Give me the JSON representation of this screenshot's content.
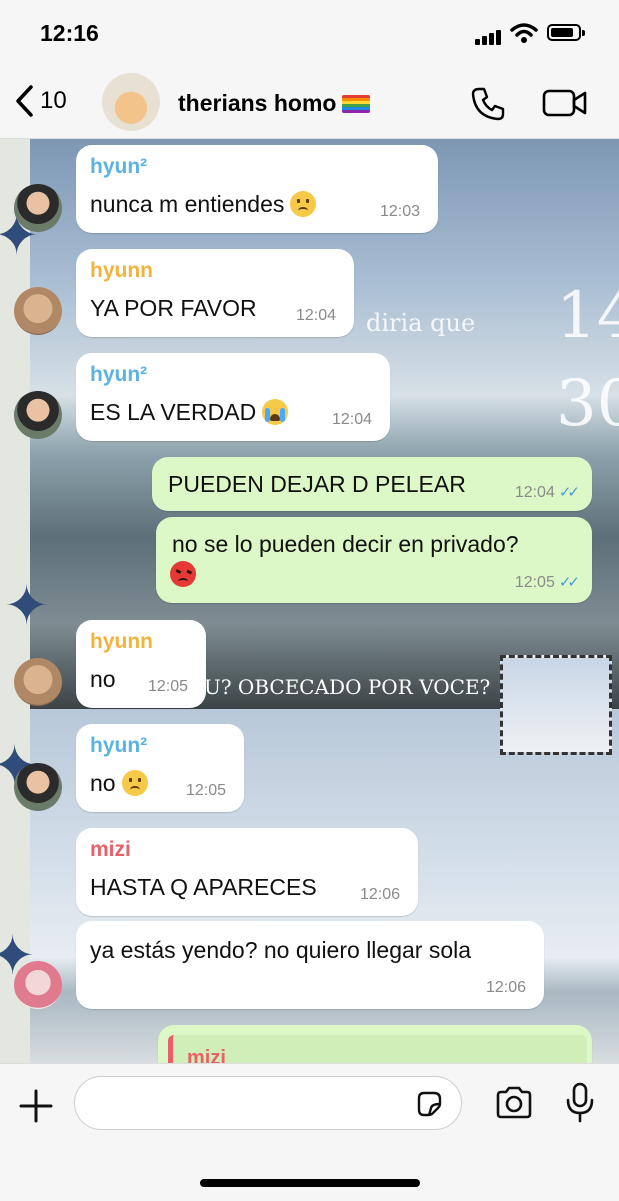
{
  "status_bar": {
    "time": "12:16"
  },
  "header": {
    "back_count": "10",
    "group_name": "therians homo",
    "group_flag_icon": "rainbow-flag-icon"
  },
  "background_text": {
    "line1": "diria que",
    "number_top": "14",
    "number_bottom": "30",
    "caption": "U? OBCECADO POR VOCE?"
  },
  "messages": [
    {
      "sender": "hyun²",
      "sender_color": "#5ab4df",
      "text": "nunca m entiendes",
      "emoji": "sad",
      "time": "12:03",
      "direction": "in"
    },
    {
      "sender": "hyunn",
      "sender_color": "#f2b33d",
      "text": "YA POR FAVOR",
      "time": "12:04",
      "direction": "in"
    },
    {
      "sender": "hyun²",
      "sender_color": "#5ab4df",
      "text": "ES LA VERDAD",
      "emoji": "cry",
      "time": "12:04",
      "direction": "in"
    },
    {
      "text": "PUEDEN DEJAR D PELEAR",
      "time": "12:04",
      "direction": "out"
    },
    {
      "text": "no se lo pueden decir en privado?",
      "emoji": "angry",
      "time": "12:05",
      "direction": "out"
    },
    {
      "sender": "hyunn",
      "sender_color": "#f2b33d",
      "text": "no",
      "time": "12:05",
      "direction": "in"
    },
    {
      "sender": "hyun²",
      "sender_color": "#5ab4df",
      "text": "no",
      "emoji": "sad",
      "time": "12:05",
      "direction": "in"
    },
    {
      "sender": "mizi",
      "sender_color": "#e8616a",
      "text": "HASTA Q APARECES",
      "time": "12:06",
      "direction": "in"
    },
    {
      "text": "ya estás yendo? no quiero llegar sola",
      "time": "12:06",
      "direction": "in"
    },
    {
      "quote_sender": "mizi",
      "direction": "out"
    }
  ],
  "input": {
    "placeholder": ""
  },
  "colors": {
    "outgoing_bubble": "#dcf8c6",
    "incoming_bubble": "#ffffff",
    "read_ticks": "#4a9be0"
  }
}
